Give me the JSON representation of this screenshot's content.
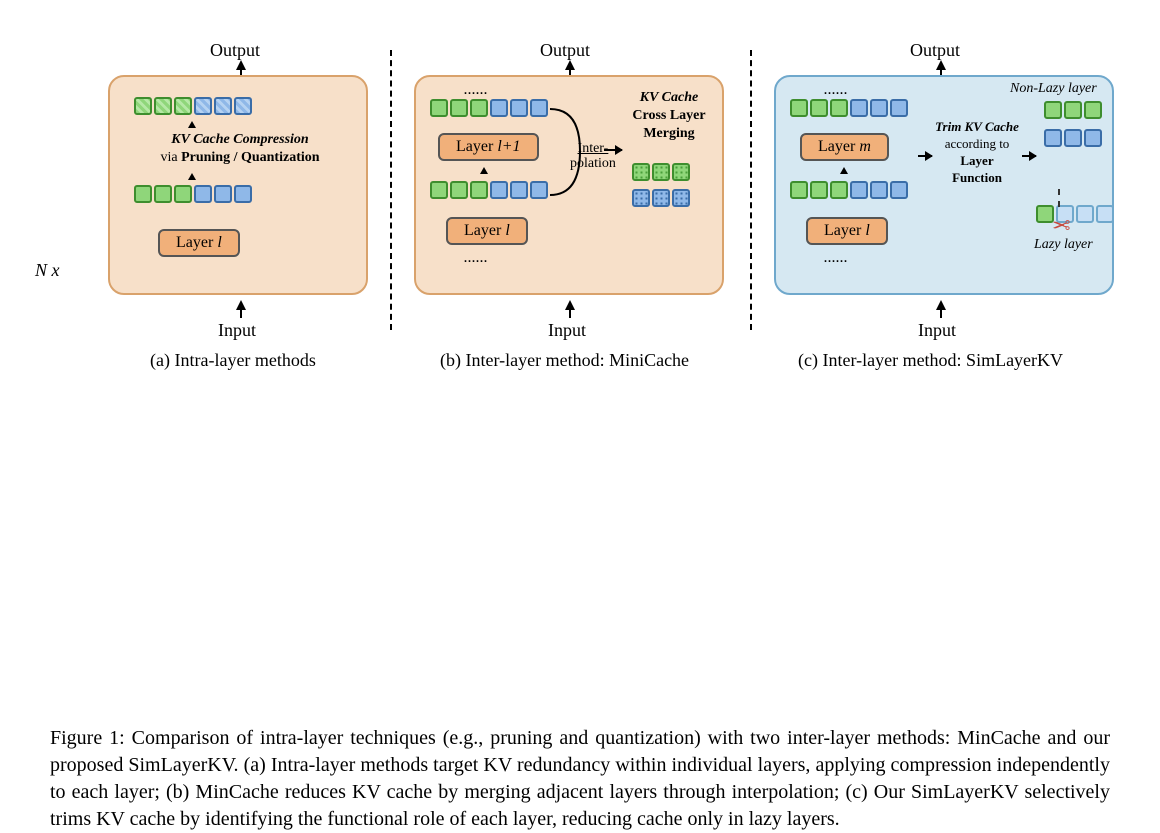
{
  "labels": {
    "output": "Output",
    "input": "Input",
    "nx": "N x"
  },
  "panelA": {
    "annotation_line1": "KV Cache Compression",
    "annotation_via": "via ",
    "annotation_line2": "Pruning / Quantization",
    "layer": "Layer ",
    "layer_var": "l",
    "subcaption": "(a) Intra-layer methods"
  },
  "panelB": {
    "annotation_line1": "KV Cache",
    "annotation_line2": "Cross Layer",
    "annotation_line3": "Merging",
    "layer1": "Layer ",
    "layer1_var": "l",
    "layer2": "Layer ",
    "layer2_var": "l+1",
    "interp1": "Inter-",
    "interp2": "polation",
    "subcaption": "(b) Inter-layer method: MiniCache"
  },
  "panelC": {
    "annotation_line1": "Trim KV Cache",
    "annotation_line2a": "according to",
    "annotation_line3": "Layer",
    "annotation_line4": "Function",
    "nonlazy": "Non-Lazy layer",
    "lazy": "Lazy layer",
    "layer1": "Layer ",
    "layer1_var": "l",
    "layer2": "Layer ",
    "layer2_var": "m",
    "subcaption": "(c) Inter-layer method: SimLayerKV"
  },
  "caption": {
    "prefix": "Figure 1:   Comparison of intra-layer techniques (e.g., pruning and quantization) with two inter-layer methods: MinCache and our proposed SimLayerKV. (a) Intra-layer methods target KV redundancy within individual layers, applying compression independently to each layer; (b) MinCache reduces KV cache by merging adjacent layers through interpolation; (c) Our SimLayerKV selectively trims KV cache by identifying the functional role of each layer, reducing cache only in lazy layers."
  },
  "ellipsis": "......"
}
